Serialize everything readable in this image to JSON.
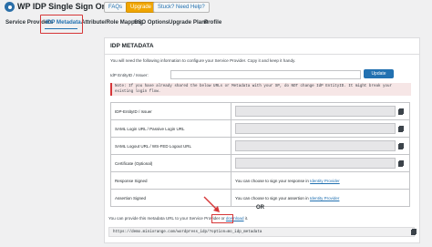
{
  "header": {
    "title": "WP IDP Single Sign On",
    "faqs": "FAQs",
    "upgrade": "Upgrade",
    "help": "Stuck? Need Help?"
  },
  "tabs": [
    "Service Providers",
    "IDP Metadata",
    "Attribute/Role Mapping",
    "SSO Options",
    "Upgrade Plans",
    "Profile"
  ],
  "panel": {
    "title": "IDP METADATA",
    "intro": "You will need the following information to configure your Service Provider. Copy it and keep it handy.",
    "entity_label": "IdP EntityID / Issuer:",
    "entity_value": "",
    "update_button": "Update",
    "note": "Note: If you have already shared the below URLs or Metadata with your SP, do NOT change IdP EntityID. It might break your existing login flow.",
    "rows": [
      {
        "label": "IDP-EntityID / Issuer",
        "value": ""
      },
      {
        "label": "SAML Login URL / Passive Login URL",
        "value": ""
      },
      {
        "label": "SAML Logout URL / WS-FED Logout URL",
        "value": ""
      },
      {
        "label": "Certificate (Optional)",
        "value": ""
      }
    ],
    "response_signed": {
      "label": "Response Signed",
      "text": "You can choose to sign your response in",
      "link": "Identity Provider"
    },
    "assertion_signed": {
      "label": "Assertion Signed",
      "text": "You can choose to sign your assertion in",
      "link": "Identity Provider"
    },
    "or": "OR",
    "download_text": "You can provide this metadata URL to your Service Provider or",
    "download_link": "download",
    "download_suffix": "it.",
    "metadata_url": "https://demo.miniorange.com/wordpress_idp/?option=mo_idp_metadata"
  },
  "colors": {
    "accent": "#2271b1",
    "highlight": "#d63638",
    "upgrade": "#f0a500"
  }
}
